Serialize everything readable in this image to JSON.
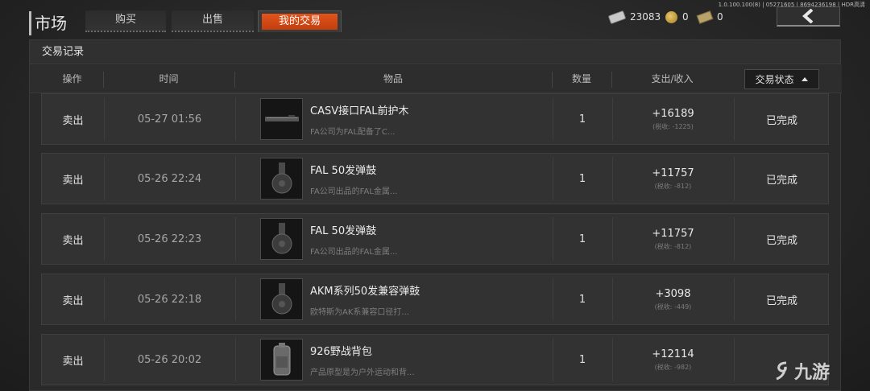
{
  "version_text": "1.0.100.100(8) | 05271605 | 8694236198 | HDR高清",
  "header": {
    "title": "市场",
    "tabs": [
      {
        "label": "购买",
        "active": false
      },
      {
        "label": "出售",
        "active": false
      },
      {
        "label": "我的交易",
        "active": true
      }
    ],
    "currencies": [
      {
        "icon": "cash-icon",
        "value": "23083"
      },
      {
        "icon": "coin-icon",
        "value": "0"
      },
      {
        "icon": "ticket-icon",
        "value": "0"
      }
    ],
    "back_icon": "chevron-left-icon"
  },
  "panel": {
    "title": "交易记录",
    "columns": [
      "操作",
      "时间",
      "物品",
      "数量",
      "支出/收入"
    ],
    "status_filter_label": "交易状态",
    "rows": [
      {
        "action": "卖出",
        "time": "05-27 01:56",
        "name": "CASV接口FAL前护木",
        "desc": "FA公司为FAL配备了C...",
        "qty": "1",
        "amount": "+16189",
        "tax": "(税收: -1225)",
        "status": "已完成",
        "thumb": "handguard-icon"
      },
      {
        "action": "卖出",
        "time": "05-26 22:24",
        "name": "FAL 50发弹鼓",
        "desc": "FA公司出品的FAL金属...",
        "qty": "1",
        "amount": "+11757",
        "tax": "(税收: -812)",
        "status": "已完成",
        "thumb": "drum-magazine-icon"
      },
      {
        "action": "卖出",
        "time": "05-26 22:23",
        "name": "FAL 50发弹鼓",
        "desc": "FA公司出品的FAL金属...",
        "qty": "1",
        "amount": "+11757",
        "tax": "(税收: -812)",
        "status": "已完成",
        "thumb": "drum-magazine-icon"
      },
      {
        "action": "卖出",
        "time": "05-26 22:18",
        "name": "AKM系列50发兼容弹鼓",
        "desc": "欧特斯为AK系兼容口径打...",
        "qty": "1",
        "amount": "+3098",
        "tax": "(税收: -449)",
        "status": "已完成",
        "thumb": "drum-magazine-icon"
      },
      {
        "action": "卖出",
        "time": "05-26 20:02",
        "name": "926野战背包",
        "desc": "产品原型是为户外运动和背...",
        "qty": "1",
        "amount": "+12114",
        "tax": "(税收: -982)",
        "status": "",
        "thumb": "backpack-icon"
      }
    ]
  },
  "watermark": "九游"
}
